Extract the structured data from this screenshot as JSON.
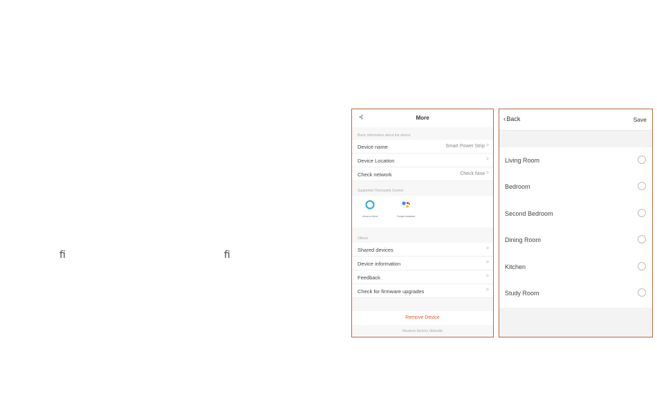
{
  "stray_glyphs": [
    "ﬁ",
    "ﬁ"
  ],
  "more_screen": {
    "title": "More",
    "back_icon": "settings-back-icon",
    "section_basic": "Basic information about the device",
    "rows_basic": [
      {
        "label": "Device name",
        "value": "Smart Power Strip",
        "chevron": ">"
      },
      {
        "label": "Device Location",
        "value": "",
        "chevron": ">"
      },
      {
        "label": "Check network",
        "value": "Check Now",
        "chevron": ">"
      }
    ],
    "section_third_party": "Supported Third-party Control",
    "third_party": [
      {
        "caption": "Amazon Alexa",
        "icon": "alexa-icon"
      },
      {
        "caption": "Google Assistant",
        "icon": "google-assistant-icon"
      }
    ],
    "section_others": "Others",
    "rows_others": [
      {
        "label": "Shared devices",
        "chevron": ">"
      },
      {
        "label": "Device information",
        "chevron": ">"
      },
      {
        "label": "Feedback",
        "chevron": ">"
      },
      {
        "label": "Check for firmware upgrades",
        "chevron": ">"
      }
    ],
    "remove_label": "Remove Device",
    "restore_label": "Restore factory defaults"
  },
  "rooms_screen": {
    "back_label": "Back",
    "back_chevron": "‹",
    "save_label": "Save",
    "rooms": [
      "Living Room",
      "Bedroom",
      "Second Bedroom",
      "Dining Room",
      "Kitchen",
      "Study Room"
    ]
  },
  "colors": {
    "accent_border": "#c0643a",
    "remove": "#e4572e"
  }
}
